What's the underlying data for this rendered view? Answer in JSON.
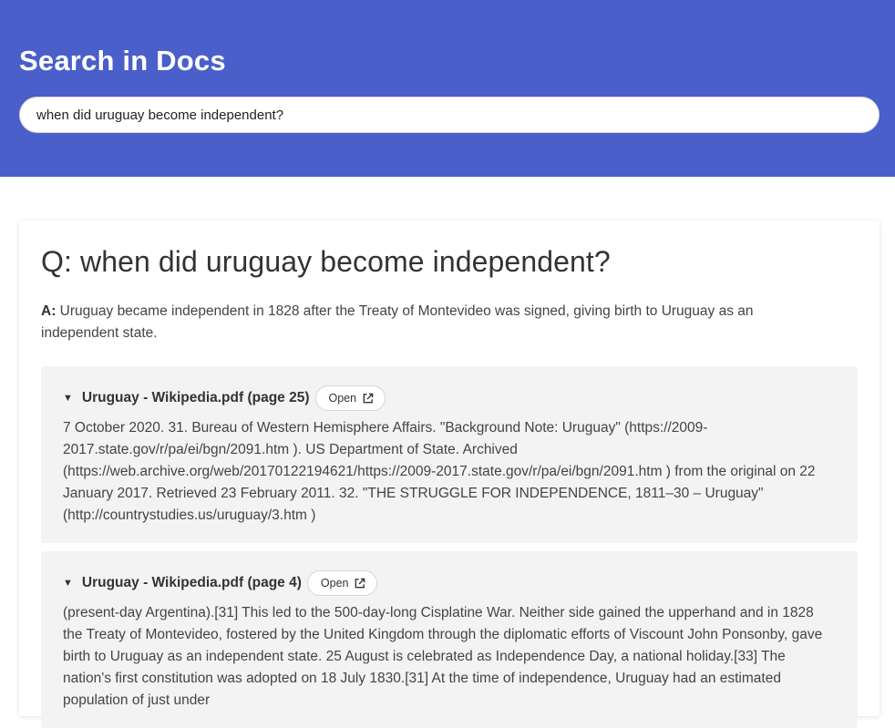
{
  "header": {
    "title": "Search in Docs",
    "search_value": "when did uruguay become independent?"
  },
  "result": {
    "question_prefix": "Q:",
    "question": "when did uruguay become independent?",
    "answer_label": "A:",
    "answer": "Uruguay became independent in 1828 after the Treaty of Montevideo was signed, giving birth to Uruguay as an independent state.",
    "sources": [
      {
        "title": "Uruguay - Wikipedia.pdf (page 25)",
        "open_label": "Open",
        "icon": "external-link-icon",
        "text": "7 October 2020. 31. Bureau of Western Hemisphere Affairs. \"Background Note: Uruguay\" (https://2009-2017.state.gov/r/pa/ei/bgn/2091.htm ). US Department of State. Archived (https://web.archive.org/web/20170122194621/https://2009-2017.state.gov/r/pa/ei/bgn/2091.htm ) from the original on 22 January 2017. Retrieved 23 February 2011. 32. \"THE STRUGGLE FOR INDEPENDENCE, 1811–30 – Uruguay\" (http://countrystudies.us/uruguay/3.htm )"
      },
      {
        "title": "Uruguay - Wikipedia.pdf (page 4)",
        "open_label": "Open",
        "icon": "external-link-icon",
        "text": "(present-day Argentina).[31] This led to the 500-day-long Cisplatine War. Neither side gained the upperhand and in 1828 the Treaty of Montevideo, fostered by the United Kingdom through the diplomatic efforts of Viscount John Ponsonby, gave birth to Uruguay as an independent state. 25 August is celebrated as Independence Day, a national holiday.[33] The nation's first constitution was adopted on 18 July 1830.[31] At the time of independence, Uruguay had an estimated population of just under"
      }
    ]
  },
  "colors": {
    "header_bg": "#4a5fc9",
    "source_bg": "#f3f3f3"
  }
}
